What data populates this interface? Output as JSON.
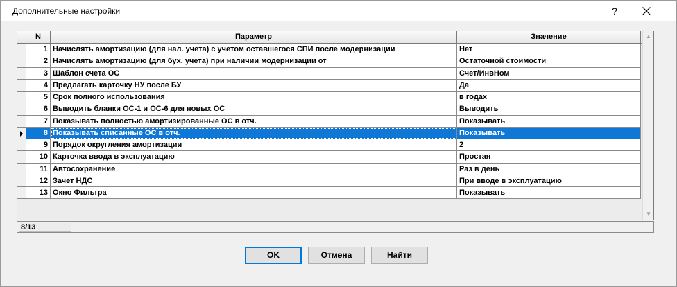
{
  "window": {
    "title": "Дополнительные настройки",
    "help": "?",
    "close_icon": "close-icon"
  },
  "grid": {
    "columns": {
      "n": "N",
      "param": "Параметр",
      "value": "Значение"
    },
    "rows": [
      {
        "n": "1",
        "param": "Начислять амортизацию (для нал. учета) с учетом оставшегося СПИ после модернизации",
        "value": "Нет"
      },
      {
        "n": "2",
        "param": "Начислять амортизацию (для бух. учета) при наличии модернизации от",
        "value": "Остаточной стоимости"
      },
      {
        "n": "3",
        "param": "Шаблон счета ОС",
        "value": "Счет/ИнвНом"
      },
      {
        "n": "4",
        "param": "Предлагать карточку НУ после БУ",
        "value": "Да"
      },
      {
        "n": "5",
        "param": "Срок полного использования",
        "value": "в годах"
      },
      {
        "n": "6",
        "param": "Выводить бланки ОС-1 и ОС-6 для новых ОС",
        "value": "Выводить"
      },
      {
        "n": "7",
        "param": "Показывать полностью амортизированные ОС в отч.",
        "value": "Показывать"
      },
      {
        "n": "8",
        "param": "Показывать списанные ОС в отч.",
        "value": "Показывать"
      },
      {
        "n": "9",
        "param": "Порядок округления амортизации",
        "value": "2"
      },
      {
        "n": "10",
        "param": "Карточка ввода в эксплуатацию",
        "value": "Простая"
      },
      {
        "n": "11",
        "param": "Автосохранение",
        "value": "Раз в день"
      },
      {
        "n": "12",
        "param": "Зачет НДС",
        "value": "При вводе в эксплуатацию"
      },
      {
        "n": "13",
        "param": "Окно Фильтра",
        "value": "Показывать"
      }
    ],
    "selected_row": 8,
    "selection_color": "#0f78d7"
  },
  "status": {
    "position": "8/13"
  },
  "buttons": {
    "ok": "OK",
    "cancel": "Отмена",
    "find": "Найти"
  }
}
